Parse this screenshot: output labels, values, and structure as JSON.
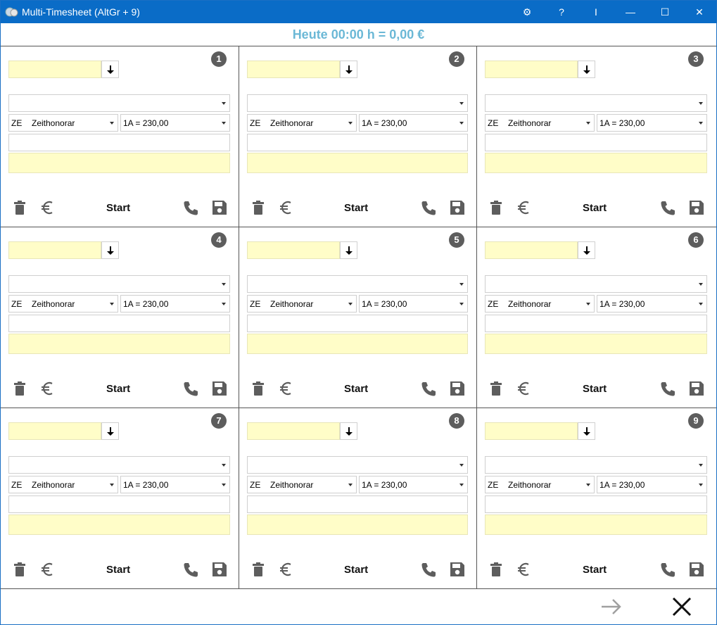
{
  "window": {
    "title": "Multi-Timesheet (AltGr + 9)",
    "controls": {
      "settings": "⚙",
      "help": "?",
      "cursor": "I",
      "minimize": "—",
      "maximize": "☐",
      "close": "✕"
    }
  },
  "summary": {
    "text": "Heute 00:00 h = 0,00 €"
  },
  "colors": {
    "titlebar": "#0a6cc7",
    "summary_text": "#6bb8d6",
    "yellow_field": "#fffdc8",
    "icon_gray": "#5d5d5d"
  },
  "panels": [
    {
      "number": "1",
      "project_value": "",
      "task_value": "",
      "type_code": "ZE",
      "type_label": "Zeithonorar",
      "rate": "1A = 230,00",
      "description": "",
      "note": "",
      "start_label": "Start"
    },
    {
      "number": "2",
      "project_value": "",
      "task_value": "",
      "type_code": "ZE",
      "type_label": "Zeithonorar",
      "rate": "1A = 230,00",
      "description": "",
      "note": "",
      "start_label": "Start"
    },
    {
      "number": "3",
      "project_value": "",
      "task_value": "",
      "type_code": "ZE",
      "type_label": "Zeithonorar",
      "rate": "1A = 230,00",
      "description": "",
      "note": "",
      "start_label": "Start"
    },
    {
      "number": "4",
      "project_value": "",
      "task_value": "",
      "type_code": "ZE",
      "type_label": "Zeithonorar",
      "rate": "1A = 230,00",
      "description": "",
      "note": "",
      "start_label": "Start"
    },
    {
      "number": "5",
      "project_value": "",
      "task_value": "",
      "type_code": "ZE",
      "type_label": "Zeithonorar",
      "rate": "1A = 230,00",
      "description": "",
      "note": "",
      "start_label": "Start"
    },
    {
      "number": "6",
      "project_value": "",
      "task_value": "",
      "type_code": "ZE",
      "type_label": "Zeithonorar",
      "rate": "1A = 230,00",
      "description": "",
      "note": "",
      "start_label": "Start"
    },
    {
      "number": "7",
      "project_value": "",
      "task_value": "",
      "type_code": "ZE",
      "type_label": "Zeithonorar",
      "rate": "1A = 230,00",
      "description": "",
      "note": "",
      "start_label": "Start"
    },
    {
      "number": "8",
      "project_value": "",
      "task_value": "",
      "type_code": "ZE",
      "type_label": "Zeithonorar",
      "rate": "1A = 230,00",
      "description": "",
      "note": "",
      "start_label": "Start"
    },
    {
      "number": "9",
      "project_value": "",
      "task_value": "",
      "type_code": "ZE",
      "type_label": "Zeithonorar",
      "rate": "1A = 230,00",
      "description": "",
      "note": "",
      "start_label": "Start"
    }
  ],
  "icons": {
    "panel": [
      "down-arrow-icon",
      "trash-icon",
      "euro-icon",
      "phone-icon",
      "save-icon"
    ],
    "footer": [
      "arrow-right-icon",
      "close-icon"
    ]
  }
}
